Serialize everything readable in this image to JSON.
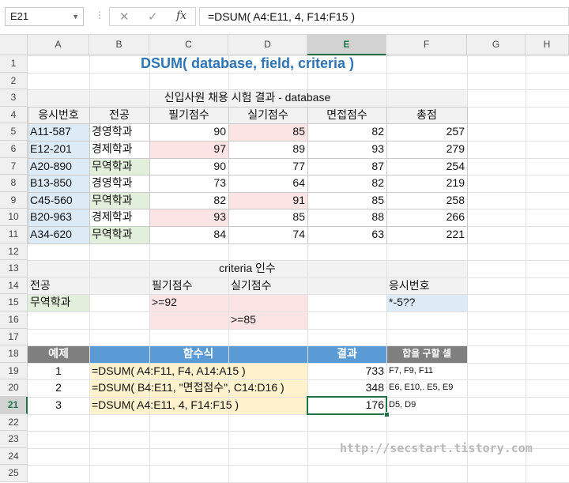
{
  "formula_bar": {
    "name_box": "E21",
    "formula": "=DSUM( A4:E11, 4, F14:F15 )",
    "cancel_icon": "✕",
    "enter_icon": "✓",
    "fx_label": "fx"
  },
  "columns": [
    "A",
    "B",
    "C",
    "D",
    "E",
    "F",
    "G",
    "H"
  ],
  "rows": [
    "1",
    "2",
    "3",
    "4",
    "5",
    "6",
    "7",
    "8",
    "9",
    "10",
    "11",
    "12",
    "13",
    "14",
    "15",
    "16",
    "17",
    "18",
    "19",
    "20",
    "21",
    "22",
    "23",
    "24",
    "25"
  ],
  "sheet": {
    "title": "DSUM( database, field, criteria )",
    "db_caption": "신입사원 채용 시험 결과 - database",
    "db_headers": [
      "응시번호",
      "전공",
      "필기점수",
      "실기점수",
      "면접점수",
      "총점"
    ],
    "db_rows": [
      [
        "A11-587",
        "경영학과",
        "90",
        "85",
        "82",
        "257"
      ],
      [
        "E12-201",
        "경제학과",
        "97",
        "89",
        "93",
        "279"
      ],
      [
        "A20-890",
        "무역학과",
        "90",
        "77",
        "87",
        "254"
      ],
      [
        "B13-850",
        "경영학과",
        "73",
        "64",
        "82",
        "219"
      ],
      [
        "C45-560",
        "무역학과",
        "82",
        "91",
        "85",
        "258"
      ],
      [
        "B20-963",
        "경제학과",
        "93",
        "85",
        "88",
        "266"
      ],
      [
        "A34-620",
        "무역학과",
        "84",
        "74",
        "63",
        "221"
      ]
    ],
    "criteria_caption": "criteria 인수",
    "crit_major_header": "전공",
    "crit_major_value": "무역학과",
    "crit_written_header": "필기점수",
    "crit_written_value": ">=92",
    "crit_practical_header": "실기점수",
    "crit_practical_value": ">=85",
    "crit_id_header": "응시번호",
    "crit_id_value": "*-5??",
    "ex_headers": [
      "예제",
      "함수식",
      "결과",
      "합을 구할 셀"
    ],
    "ex_rows": [
      [
        "1",
        "=DSUM( A4:F11, F4, A14:A15 )",
        "733",
        "F7, F9, F11"
      ],
      [
        "2",
        "=DSUM( B4:E11, \"면접점수\", C14:D16 )",
        "348",
        "E6, E10,. E5, E9"
      ],
      [
        "3",
        "=DSUM( A4:E11, 4, F14:F15 )",
        "176",
        "D5, D9"
      ]
    ]
  },
  "watermark": "http://secstart.tistory.com",
  "colors": {
    "title": "#2e75b6",
    "header_band": "#f2f2f2",
    "example_header": "#7f7f7f",
    "example_formula_header": "#5b9bd5",
    "formula_fill": "#fff2cc",
    "major_fill": "#e2efda",
    "id_fill": "#ddebf7",
    "score_fill": "#fce4e4",
    "selection": "#217346"
  }
}
